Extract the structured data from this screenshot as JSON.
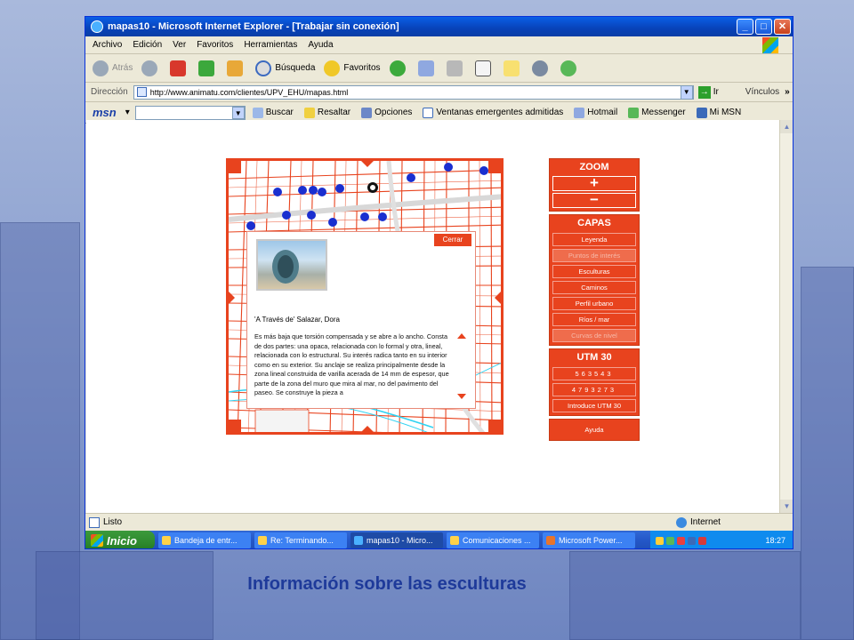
{
  "window": {
    "title": "mapas10 - Microsoft Internet Explorer - [Trabajar sin conexión]",
    "buttons": {
      "minimize": "_",
      "maximize": "□",
      "close": "✕"
    }
  },
  "menu": [
    "Archivo",
    "Edición",
    "Ver",
    "Favoritos",
    "Herramientas",
    "Ayuda"
  ],
  "toolbar": {
    "back": "Atrás",
    "search": "Búsqueda",
    "favorites": "Favoritos"
  },
  "address": {
    "label": "Dirección",
    "url": "http://www.animatu.com/clientes/UPV_EHU/mapas.html",
    "go": "Ir",
    "links": "Vínculos"
  },
  "msn": {
    "logo": "msn",
    "search": "Buscar",
    "highlight": "Resaltar",
    "options": "Opciones",
    "popups": "Ventanas emergentes admitidas",
    "hotmail": "Hotmail",
    "messenger": "Messenger",
    "mymsn": "Mi MSN"
  },
  "map": {
    "info": {
      "close": "Cerrar",
      "title": "'A Través de'  Salazar, Dora",
      "body": "Es más baja que torsión compensada y se abre a lo ancho. Consta de dos partes: una opaca, relacionada con lo formal y otra, lineal, relacionada con lo estructural. Su interés radica tanto en su interior como en su exterior. Su anclaje se realiza principalmente desde la zona lineal construida de varilla acerada de 14 mm de espesor, que parte de la zona del muro que mira al mar, no del pavimento del paseo. Se construye la pieza a"
    }
  },
  "controls": {
    "zoom": {
      "title": "ZOOM",
      "in": "+",
      "out": "−"
    },
    "layers": {
      "title": "CAPAS",
      "items": [
        {
          "label": "Leyenda",
          "enabled": true
        },
        {
          "label": "Puntos de interés",
          "enabled": false
        },
        {
          "label": "Esculturas",
          "enabled": true
        },
        {
          "label": "Caminos",
          "enabled": true
        },
        {
          "label": "Perfil urbano",
          "enabled": true
        },
        {
          "label": "Ríos / mar",
          "enabled": true
        },
        {
          "label": "Curvas de nivel",
          "enabled": false
        }
      ]
    },
    "utm": {
      "title": "UTM 30",
      "x": "563543",
      "y": "4793273",
      "enter": "Introduce  UTM 30"
    },
    "help": "Ayuda"
  },
  "status": {
    "text": "Listo",
    "zone": "Internet"
  },
  "taskbar": {
    "start": "Inicio",
    "tasks": [
      {
        "label": "Bandeja de entr...",
        "active": false
      },
      {
        "label": "Re: Terminando...",
        "active": false
      },
      {
        "label": "mapas10 - Micro...",
        "active": true
      },
      {
        "label": "Comunicaciones ...",
        "active": false
      },
      {
        "label": "Microsoft Power...",
        "active": false
      }
    ],
    "clock": "18:27"
  },
  "caption": "Información sobre las esculturas",
  "colors": {
    "accent": "#e8431e",
    "poi": "#1a2fd0",
    "caption": "#1e3a9a"
  }
}
